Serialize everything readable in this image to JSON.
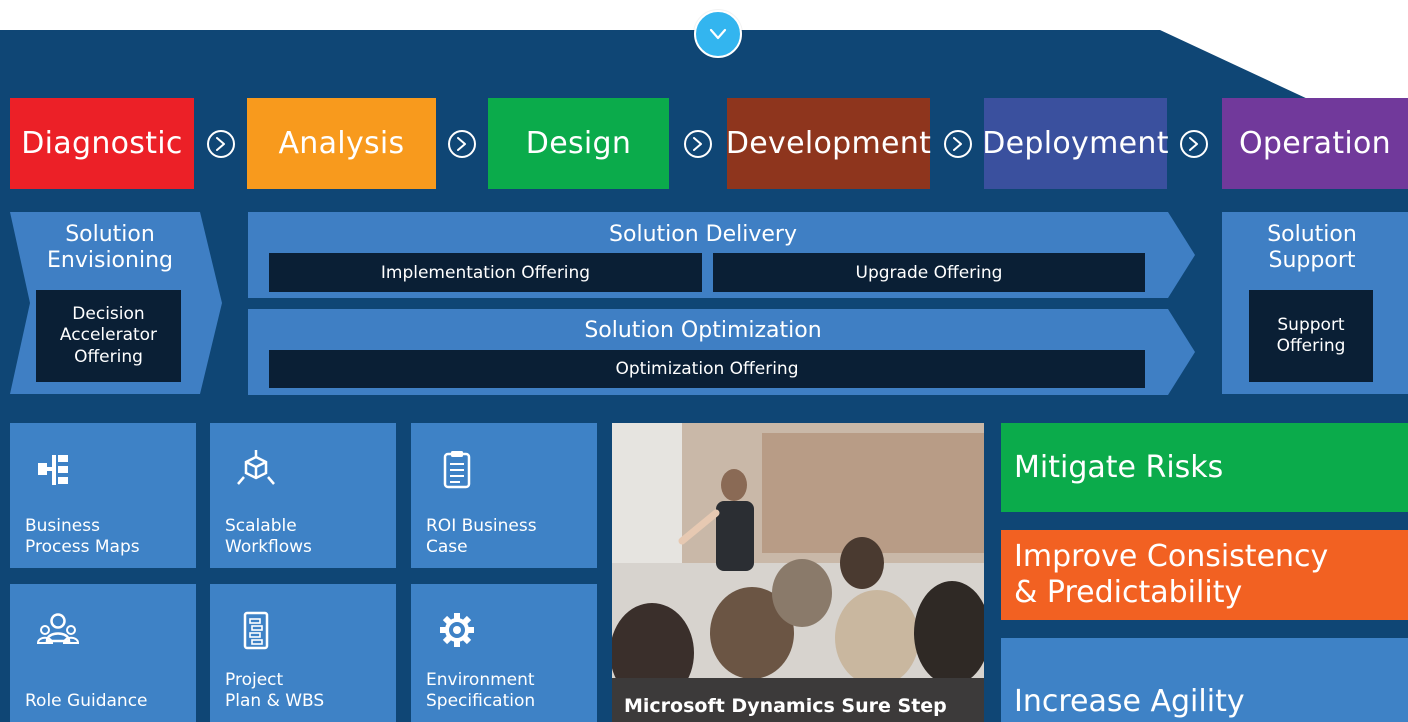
{
  "scroll_down": {
    "icon": "chevron-down-icon"
  },
  "colors": {
    "background": "#0f4675",
    "chevron": "#3f7fc4",
    "dark_box": "#0a1f35",
    "tile": "#3e82c6",
    "scroll_button": "#33b5ef"
  },
  "phases": [
    {
      "label": "Diagnostic",
      "color": "#ec2027"
    },
    {
      "label": "Analysis",
      "color": "#f89a1d"
    },
    {
      "label": "Design",
      "color": "#0bab4b"
    },
    {
      "label": "Development",
      "color": "#8e351d"
    },
    {
      "label": "Deployment",
      "color": "#3a509e"
    },
    {
      "label": "Operation",
      "color": "#71399b"
    }
  ],
  "phase_arrow_icon": "circle-chevron-right-icon",
  "envisioning": {
    "title": "Solution\nEnvisioning",
    "offering": "Decision\nAccelerator\nOffering"
  },
  "delivery": {
    "title": "Solution Delivery",
    "offerings": [
      "Implementation Offering",
      "Upgrade Offering"
    ]
  },
  "optimization": {
    "title": "Solution Optimization",
    "offering": "Optimization Offering"
  },
  "support": {
    "title": "Solution\nSupport",
    "offering": "Support\nOffering"
  },
  "tiles": [
    {
      "label": "Business\nProcess Maps",
      "icon": "process-map-icon"
    },
    {
      "label": "Scalable\nWorkflows",
      "icon": "workflow-cube-icon"
    },
    {
      "label": "ROI Business\nCase",
      "icon": "clipboard-checklist-icon"
    },
    {
      "label": "Role Guidance",
      "icon": "people-group-icon"
    },
    {
      "label": "Project\nPlan & WBS",
      "icon": "project-plan-icon"
    },
    {
      "label": "Environment\nSpecification",
      "icon": "gear-icon"
    }
  ],
  "photo": {
    "caption": "Microsoft Dynamics Sure Step"
  },
  "benefits": [
    {
      "label": "Mitigate Risks",
      "color": "#0bab4b"
    },
    {
      "label": "Improve Consistency\n& Predictability",
      "color": "#f26122"
    },
    {
      "label": "Increase Agility",
      "color": "#3e82c6"
    }
  ]
}
